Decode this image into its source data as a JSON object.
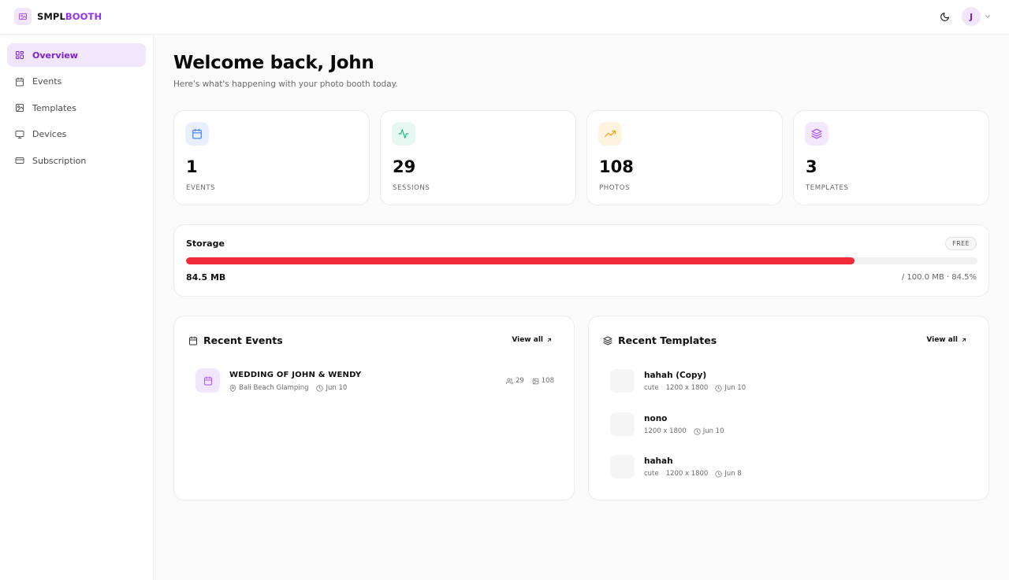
{
  "brand": {
    "prefix": "SMPL",
    "accent": "BOOTH"
  },
  "user": {
    "initial": "J"
  },
  "sidebar": {
    "items": [
      {
        "label": "Overview",
        "icon": "layout-grid-icon",
        "active": true
      },
      {
        "label": "Events",
        "icon": "calendar-icon"
      },
      {
        "label": "Templates",
        "icon": "image-icon"
      },
      {
        "label": "Devices",
        "icon": "monitor-icon"
      },
      {
        "label": "Subscription",
        "icon": "credit-card-icon"
      }
    ]
  },
  "header": {
    "title": "Welcome back, John",
    "subtitle": "Here's what's happening with your photo booth today."
  },
  "stats": [
    {
      "value": "1",
      "label": "EVENTS",
      "icon": "calendar-icon",
      "color": "#3b82f6",
      "bg": "#e8f0fe"
    },
    {
      "value": "29",
      "label": "SESSIONS",
      "icon": "activity-icon",
      "color": "#10b981",
      "bg": "#e7f8f1"
    },
    {
      "value": "108",
      "label": "PHOTOS",
      "icon": "trending-up-icon",
      "color": "#f59e0b",
      "bg": "#fdf3df"
    },
    {
      "value": "3",
      "label": "TEMPLATES",
      "icon": "layers-icon",
      "color": "#a855f7",
      "bg": "#f3e8fd"
    }
  ],
  "storage": {
    "title": "Storage",
    "plan": "FREE",
    "used": "84.5 MB",
    "total": "/ 100.0 MB · 84.5%",
    "percent": 84.5,
    "bar_color": "#ef2b3a"
  },
  "recent_events": {
    "title": "Recent Events",
    "view_all": "View all",
    "items": [
      {
        "name": "WEDDING OF JOHN & WENDY",
        "location": "Bali Beach Glamping",
        "date": "Jun 10",
        "sessions": "29",
        "photos": "108"
      }
    ]
  },
  "recent_templates": {
    "title": "Recent Templates",
    "view_all": "View all",
    "items": [
      {
        "name": "hahah (Copy)",
        "tag": "cute",
        "size": "1200 x 1800",
        "date": "Jun 10"
      },
      {
        "name": "nono",
        "tag": "",
        "size": "1200 x 1800",
        "date": "Jun 10"
      },
      {
        "name": "hahah",
        "tag": "cute",
        "size": "1200 x 1800",
        "date": "Jun 8"
      }
    ]
  },
  "colors": {
    "accent": "#9333ea",
    "accent_bg": "#f1e6fb"
  }
}
